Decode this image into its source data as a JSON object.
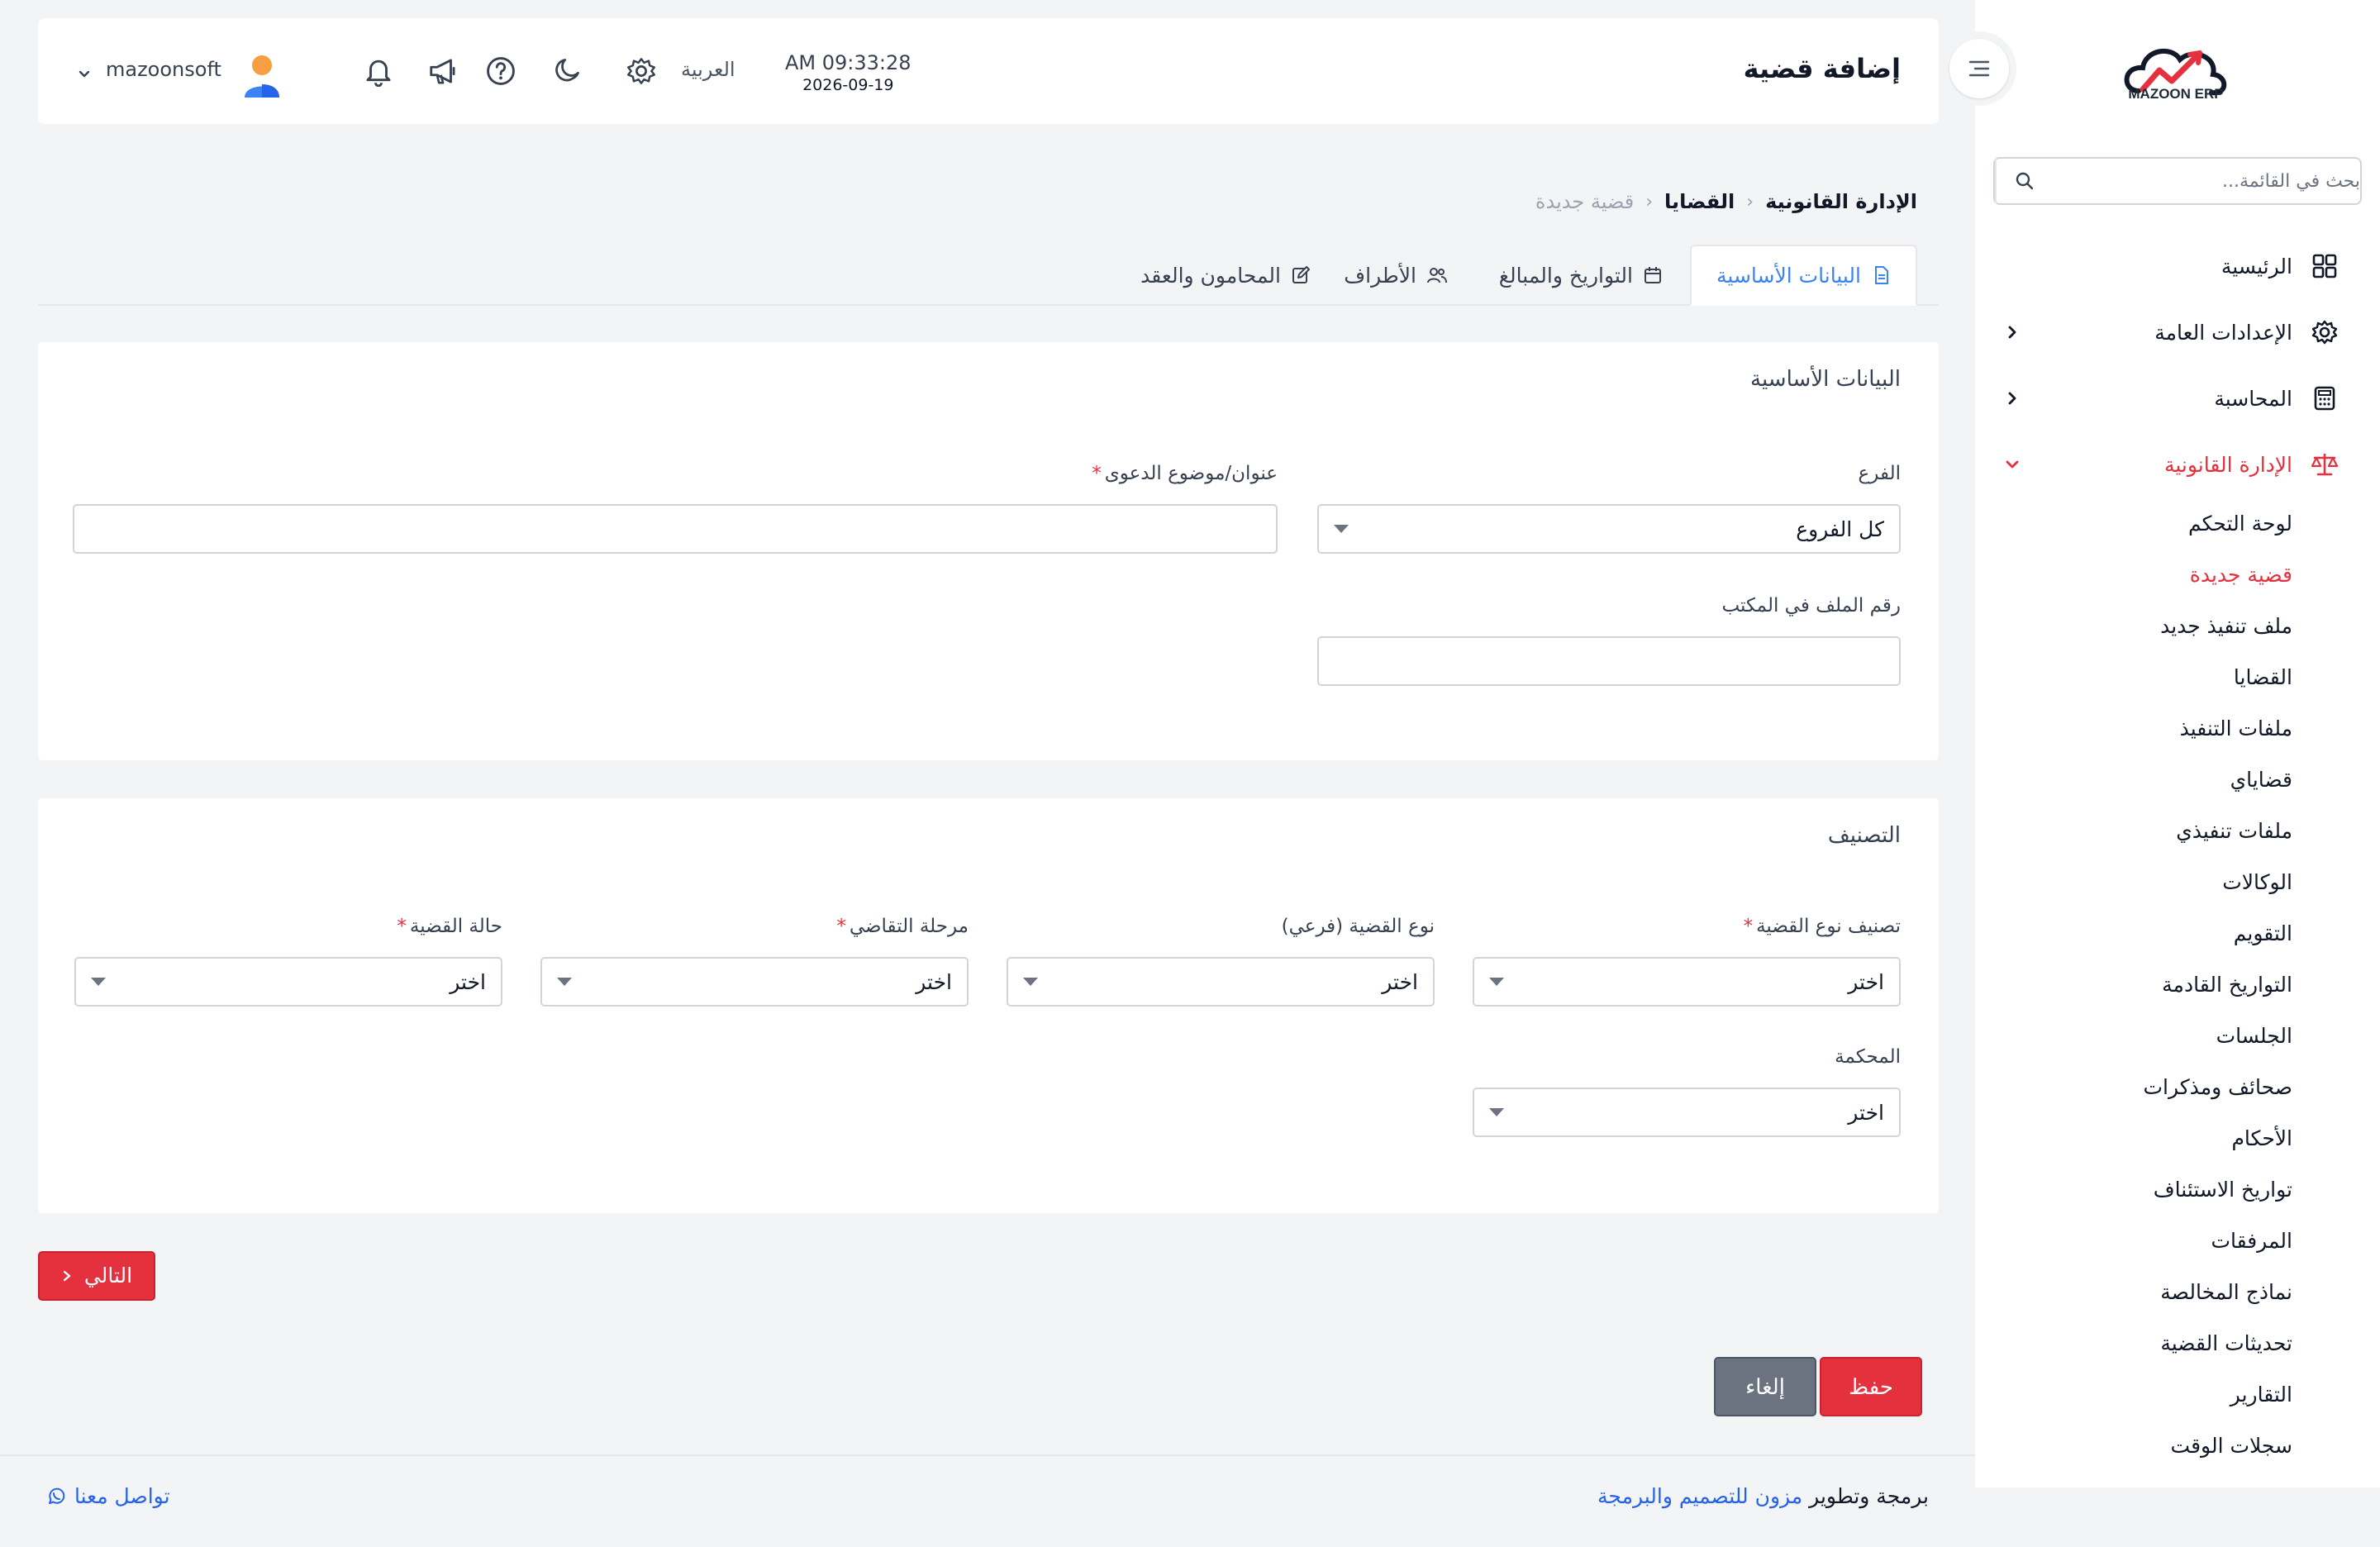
{
  "app": {
    "logo_text": "MAZOON ERP",
    "accent_color": "#e5303d",
    "link_color": "#2563eb"
  },
  "sidebar": {
    "search_placeholder": "بحث في القائمة...",
    "items": [
      {
        "label": "الرئيسية",
        "icon": "grid-icon"
      },
      {
        "label": "الإعدادات العامة",
        "icon": "gear-icon"
      },
      {
        "label": "المحاسبة",
        "icon": "calculator-icon"
      },
      {
        "label": "الإدارة القانونية",
        "icon": "scale-icon"
      }
    ],
    "legal_sub_items": [
      "لوحة التحكم",
      "قضية جديدة",
      "ملف تنفيذ جديد",
      "القضايا",
      "ملفات التنفيذ",
      "قضاياي",
      "ملفات تنفيذي",
      "الوكالات",
      "التقويم",
      "التواريخ القادمة",
      "الجلسات",
      "صحائف ومذكرات",
      "الأحكام",
      "تواريخ الاستئناف",
      "المرفقات",
      "نماذج المخالصة",
      "تحديثات القضية",
      "التقارير",
      "سجلات الوقت"
    ]
  },
  "header": {
    "title": "إضافة قضية",
    "time": "AM 09:33:28",
    "date": "2026-09-19",
    "language": "العربية",
    "username": "mazoonsoft"
  },
  "breadcrumb": {
    "root": "الإدارة القانونية",
    "section": "القضايا",
    "current": "قضية جديدة"
  },
  "tabs": [
    "البيانات الأساسية",
    "التواريخ والمبالغ",
    "الأطراف",
    "المحامون والعقد"
  ],
  "basic_card": {
    "title": "البيانات الأساسية",
    "branch_label": "الفرع",
    "branch_value": "كل الفروع",
    "subject_label": "عنوان/موضوع الدعوى",
    "file_no_label": "رقم الملف في المكتب"
  },
  "class_card": {
    "title": "التصنيف",
    "case_type_class_label": "تصنيف نوع القضية",
    "case_subtype_label": "نوع القضية (فرعي)",
    "litigation_stage_label": "مرحلة التقاضي",
    "case_status_label": "حالة القضية",
    "court_label": "المحكمة",
    "select_placeholder": "اختر"
  },
  "actions": {
    "next": "التالي",
    "save": "حفظ",
    "cancel": "إلغاء"
  },
  "footer": {
    "credit_prefix": "برمجة وتطوير",
    "credit_company": "مزون للتصميم والبرمجة",
    "contact": "تواصل معنا"
  }
}
